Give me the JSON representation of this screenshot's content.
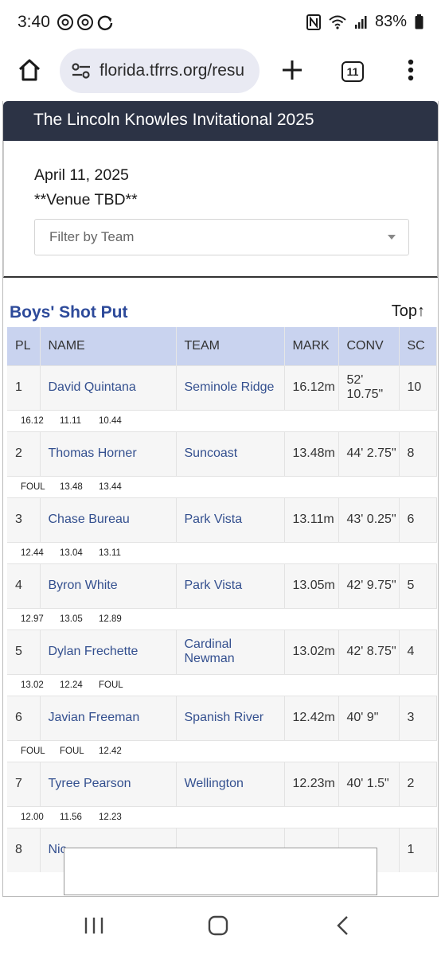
{
  "status": {
    "time": "3:40",
    "battery": "83%"
  },
  "browser": {
    "url": "florida.tfrrs.org/resu",
    "tab_count": "11"
  },
  "meet": {
    "title": "The Lincoln Knowles Invitational 2025",
    "date": "April 11, 2025",
    "venue": "**Venue TBD**",
    "filter_placeholder": "Filter by Team"
  },
  "event": {
    "title": "Boys' Shot Put",
    "top_link": "Top↑"
  },
  "table": {
    "headers": [
      "PL",
      "NAME",
      "TEAM",
      "MARK",
      "CONV",
      "SC"
    ],
    "rows": [
      {
        "pl": "1",
        "name": "David Quintana",
        "team": "Seminole Ridge",
        "mark": "16.12m",
        "conv": "52' 10.75\"",
        "sc": "10",
        "splits": [
          "16.12",
          "11.11",
          "10.44"
        ]
      },
      {
        "pl": "2",
        "name": "Thomas Horner",
        "team": "Suncoast",
        "mark": "13.48m",
        "conv": "44' 2.75\"",
        "sc": "8",
        "splits": [
          "FOUL",
          "13.48",
          "13.44"
        ]
      },
      {
        "pl": "3",
        "name": "Chase Bureau",
        "team": "Park Vista",
        "mark": "13.11m",
        "conv": "43' 0.25\"",
        "sc": "6",
        "splits": [
          "12.44",
          "13.04",
          "13.11"
        ]
      },
      {
        "pl": "4",
        "name": "Byron White",
        "team": "Park Vista",
        "mark": "13.05m",
        "conv": "42' 9.75\"",
        "sc": "5",
        "splits": [
          "12.97",
          "13.05",
          "12.89"
        ]
      },
      {
        "pl": "5",
        "name": "Dylan Frechette",
        "team": "Cardinal Newman",
        "mark": "13.02m",
        "conv": "42' 8.75\"",
        "sc": "4",
        "splits": [
          "13.02",
          "12.24",
          "FOUL"
        ]
      },
      {
        "pl": "6",
        "name": "Javian Freeman",
        "team": "Spanish River",
        "mark": "12.42m",
        "conv": "40' 9\"",
        "sc": "3",
        "splits": [
          "FOUL",
          "FOUL",
          "12.42"
        ]
      },
      {
        "pl": "7",
        "name": "Tyree Pearson",
        "team": "Wellington",
        "mark": "12.23m",
        "conv": "40' 1.5\"",
        "sc": "2",
        "splits": [
          "12.00",
          "11.56",
          "12.23"
        ]
      },
      {
        "pl": "8",
        "name": "Nic",
        "team": "",
        "mark": "",
        "conv": "",
        "sc": "1",
        "splits": []
      }
    ]
  },
  "icons": {
    "home": "home-icon",
    "tune": "site-settings-icon",
    "plus": "new-tab-icon",
    "tabs": "tab-switcher-icon",
    "menu": "more-vert-icon",
    "recents": "recents-icon",
    "home_nav": "nav-home-icon",
    "back": "back-icon"
  },
  "colors": {
    "header_bg": "#2c3345",
    "table_head": "#c9d3ef",
    "link": "#34508f",
    "event_title": "#2d4a9a"
  }
}
